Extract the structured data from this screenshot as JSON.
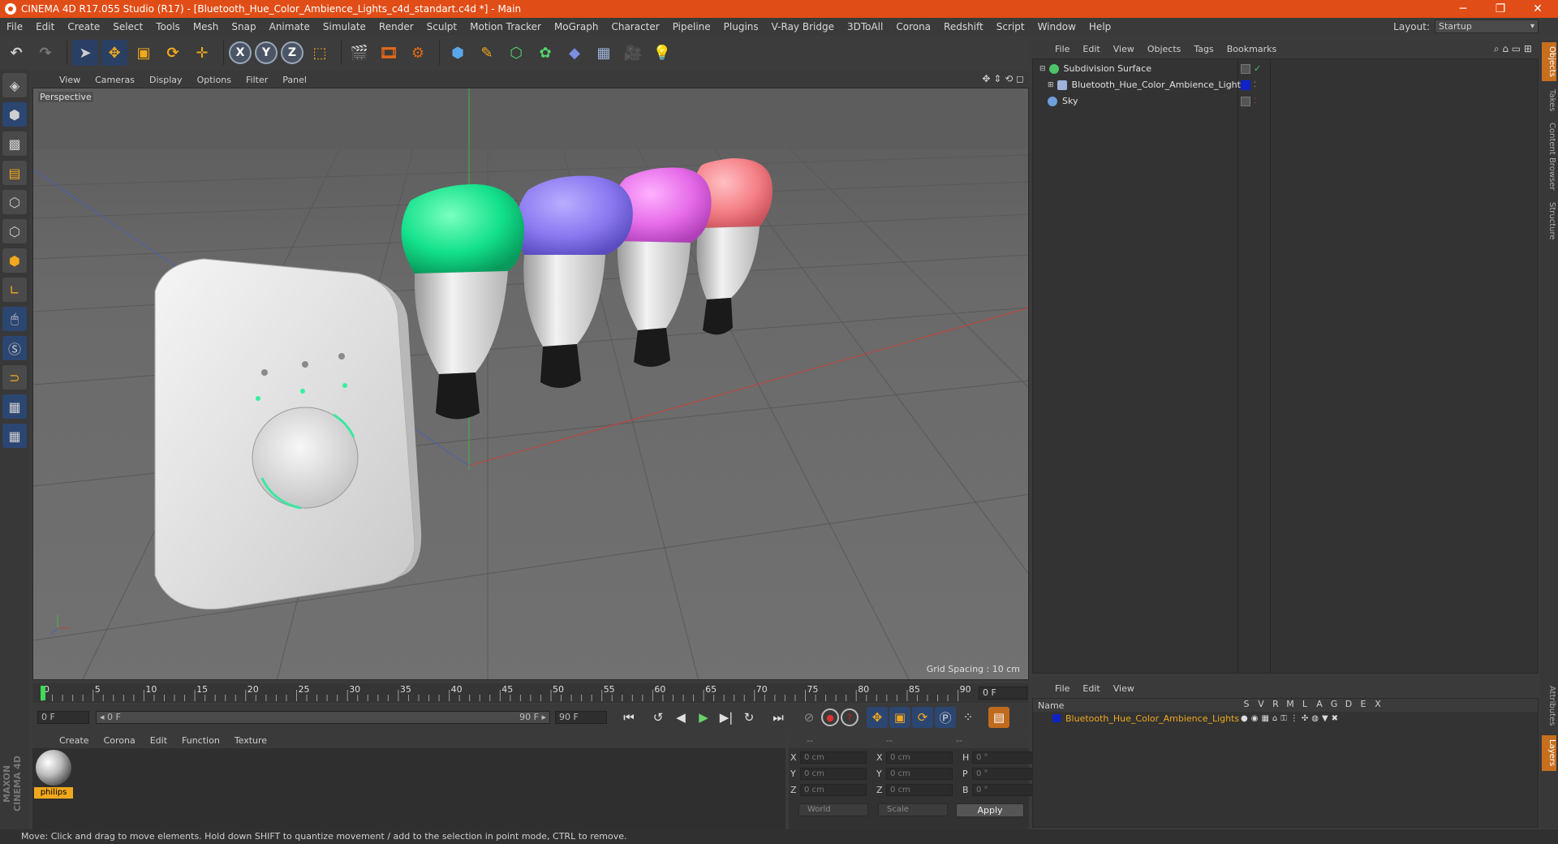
{
  "window": {
    "title": "CINEMA 4D R17.055 Studio (R17) - [Bluetooth_Hue_Color_Ambience_Lights_c4d_standart.c4d *] - Main",
    "minimize": "─",
    "maximize": "❐",
    "close": "✕"
  },
  "menu": [
    "File",
    "Edit",
    "Create",
    "Select",
    "Tools",
    "Mesh",
    "Snap",
    "Animate",
    "Simulate",
    "Render",
    "Sculpt",
    "Motion Tracker",
    "MoGraph",
    "Character",
    "Pipeline",
    "Plugins",
    "V-Ray Bridge",
    "3DToAll",
    "Corona",
    "Redshift",
    "Script",
    "Window",
    "Help"
  ],
  "layout": {
    "label": "Layout:",
    "value": "Startup"
  },
  "viewport": {
    "menu": [
      "View",
      "Cameras",
      "Display",
      "Options",
      "Filter",
      "Panel"
    ],
    "label": "Perspective",
    "grid_spacing": "Grid Spacing : 10 cm",
    "nav_icons": "✥ ⇕ ⟲ ◻"
  },
  "timeline": {
    "ticks": [
      "0",
      "5",
      "10",
      "15",
      "20",
      "25",
      "30",
      "35",
      "40",
      "45",
      "50",
      "55",
      "60",
      "65",
      "70",
      "75",
      "80",
      "85",
      "90"
    ],
    "current_frame": "0 F",
    "start_field": "0 F",
    "range_start": "◂ 0 F",
    "range_end": "90 F ▸",
    "end_field": "90 F"
  },
  "material_manager": {
    "menu": [
      "Create",
      "Corona",
      "Edit",
      "Function",
      "Texture"
    ],
    "materials": [
      {
        "name": "philips"
      }
    ]
  },
  "coordinates": {
    "headers": [
      "--",
      "--",
      "--"
    ],
    "rows": [
      {
        "a1": "X",
        "v1": "0 cm",
        "a2": "X",
        "v2": "0 cm",
        "a3": "H",
        "v3": "0 °"
      },
      {
        "a1": "Y",
        "v1": "0 cm",
        "a2": "Y",
        "v2": "0 cm",
        "a3": "P",
        "v3": "0 °"
      },
      {
        "a1": "Z",
        "v1": "0 cm",
        "a2": "Z",
        "v2": "0 cm",
        "a3": "B",
        "v3": "0 °"
      }
    ],
    "space": "World",
    "mode": "Scale",
    "apply": "Apply"
  },
  "status": "Move: Click and drag to move elements. Hold down SHIFT to quantize movement / add to the selection in point mode, CTRL to remove.",
  "object_manager": {
    "menu": [
      "File",
      "Edit",
      "View",
      "Objects",
      "Tags",
      "Bookmarks"
    ],
    "objects": [
      {
        "name": "Subdivision Surface",
        "icon_color": "#4ec26a"
      },
      {
        "name": "Bluetooth_Hue_Color_Ambience_Lights",
        "icon_color": "#9fb3d9"
      },
      {
        "name": "Sky",
        "icon_color": "#6ea0dc"
      }
    ]
  },
  "layer_manager": {
    "menu": [
      "File",
      "Edit",
      "View"
    ],
    "name_header": "Name",
    "columns": [
      "S",
      "V",
      "R",
      "M",
      "L",
      "A",
      "G",
      "D",
      "E",
      "X"
    ],
    "layers": [
      {
        "name": "Bluetooth_Hue_Color_Ambience_Lights",
        "color": "#1022c8"
      }
    ]
  },
  "side_tabs": [
    "Objects",
    "Takes",
    "Content Browser",
    "Structure",
    "Attributes",
    "Layers"
  ],
  "brand": "MAXON CINEMA 4D",
  "scene_colors": {
    "bulb_green": "#12e08a",
    "bulb_purple": "#8a78f0",
    "bulb_pink": "#e56ae8",
    "bulb_salmon": "#f47f86",
    "bridge": "#e2e2e2"
  }
}
